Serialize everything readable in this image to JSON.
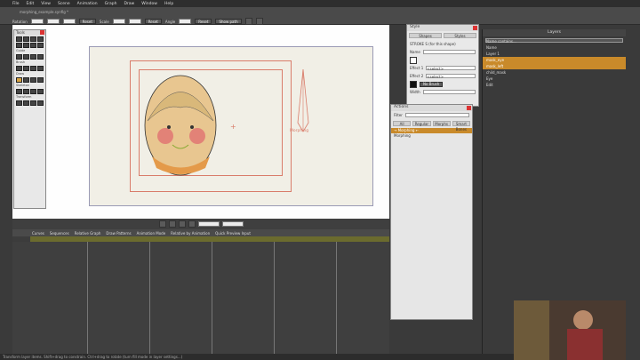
{
  "menu": [
    "File",
    "Edit",
    "View",
    "Scene",
    "Animation",
    "Graph",
    "Draw",
    "Window",
    "Help"
  ],
  "toolbar": {
    "doc_title": "morphing_example.synfig *",
    "rotation_label": "Rotation",
    "reset_label": "Reset",
    "scale_label": "Scale",
    "angle_label": "Angle",
    "show_path_label": "Show path"
  },
  "canvas": {
    "annotation": "Morphing",
    "accent": "#d97c6a"
  },
  "tools_panel": {
    "title": "Tools",
    "sections": [
      "Guide",
      "Brush",
      "Draw",
      "Skeleton",
      "Transform"
    ]
  },
  "timeline": {
    "tabs": [
      "Curves",
      "Sequences",
      "Relative Graph",
      "Draw Patterns",
      "Animation Mode",
      "Relative by Animation",
      "Quick Preview Input"
    ],
    "ruler_color": "#6b6b2e"
  },
  "style_panel": {
    "title": "Style",
    "tabs": [
      "Shapes",
      "Styles"
    ],
    "stroke_label": "STROKE S (for this shape)",
    "name_label": "Name",
    "effect1_label": "Effect 1",
    "effect2_label": "Effect 2",
    "width_label": "Width",
    "option_label": "<select>",
    "no_brush_label": "No Brush"
  },
  "actions_panel": {
    "title": "Actions",
    "filter_label": "Filter",
    "tabs": [
      "All",
      "Regular",
      "Morphs",
      "Smart Bones"
    ],
    "items": [
      "→ Morphing ←",
      "Morphing"
    ]
  },
  "layers_panel": {
    "title": "Layers",
    "search_placeholder": "Name contains...",
    "rows": [
      {
        "label": "Name",
        "sel": false
      },
      {
        "label": "Layer 1",
        "sel": false
      },
      {
        "label": "mask_eye",
        "sel": true
      },
      {
        "label": "mask_left",
        "sel": true
      },
      {
        "label": "child_mask",
        "sel": false
      },
      {
        "label": "Eye",
        "sel": false
      },
      {
        "label": "Edit",
        "sel": false
      }
    ]
  },
  "status": "Transform layer items. Shift+drag to constrain. Ctrl+drag to rotate (turn fill mode in layer settings...)"
}
